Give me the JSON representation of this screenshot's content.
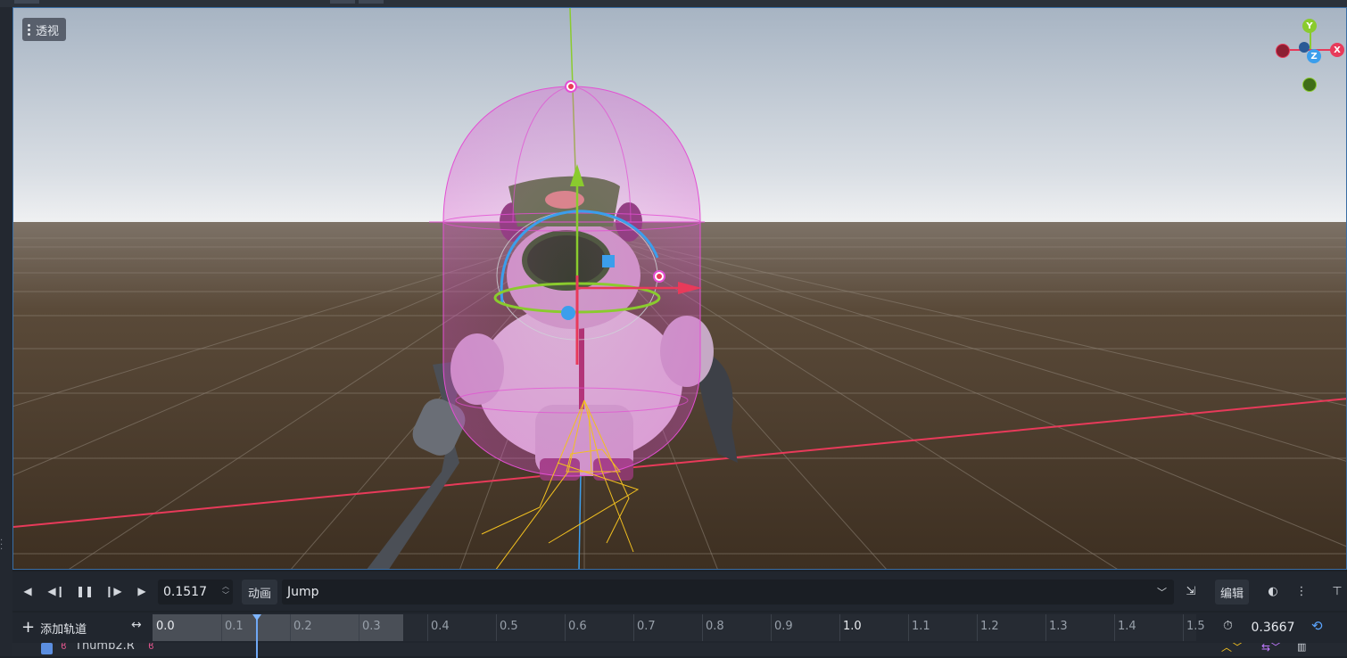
{
  "viewport": {
    "perspective_button": {
      "label": "透视",
      "icon": "kebab-menu-icon"
    },
    "axis_gizmo": {
      "x_label": "X",
      "y_label": "Y",
      "z_label": "Z"
    }
  },
  "animation_toolbar": {
    "buttons": [
      {
        "name": "play-backwards-from-end-button",
        "icon": "play-backwards-icon"
      },
      {
        "name": "play-backwards-button",
        "icon": "play-backwards-from-current-icon"
      },
      {
        "name": "pause-button",
        "icon": "pause-icon"
      },
      {
        "name": "play-from-current-button",
        "icon": "play-from-current-icon"
      },
      {
        "name": "play-from-start-button",
        "icon": "play-icon"
      }
    ],
    "current_time": "0.1517",
    "animation_menu_label": "动画",
    "animation_name": "Jump",
    "edit_label": "编辑"
  },
  "timeline": {
    "add_track_label": "添加轨道",
    "ticks": [
      "0.0",
      "0.1",
      "0.2",
      "0.3",
      "0.4",
      "0.5",
      "0.6",
      "0.7",
      "0.8",
      "0.9",
      "1.0",
      "1.1",
      "1.2",
      "1.3",
      "1.4",
      "1.5"
    ],
    "animation_length": "0.3667",
    "current_time_fraction": 0.1517
  },
  "tracks": [
    {
      "name": "Thumb2.R",
      "enabled": true
    }
  ],
  "colors": {
    "accent": "#5b8ee0",
    "x_axis": "#e83a5a",
    "y_axis": "#8acb2e",
    "z_axis": "#3b9eec",
    "collision_shape": "#e34fd3"
  }
}
